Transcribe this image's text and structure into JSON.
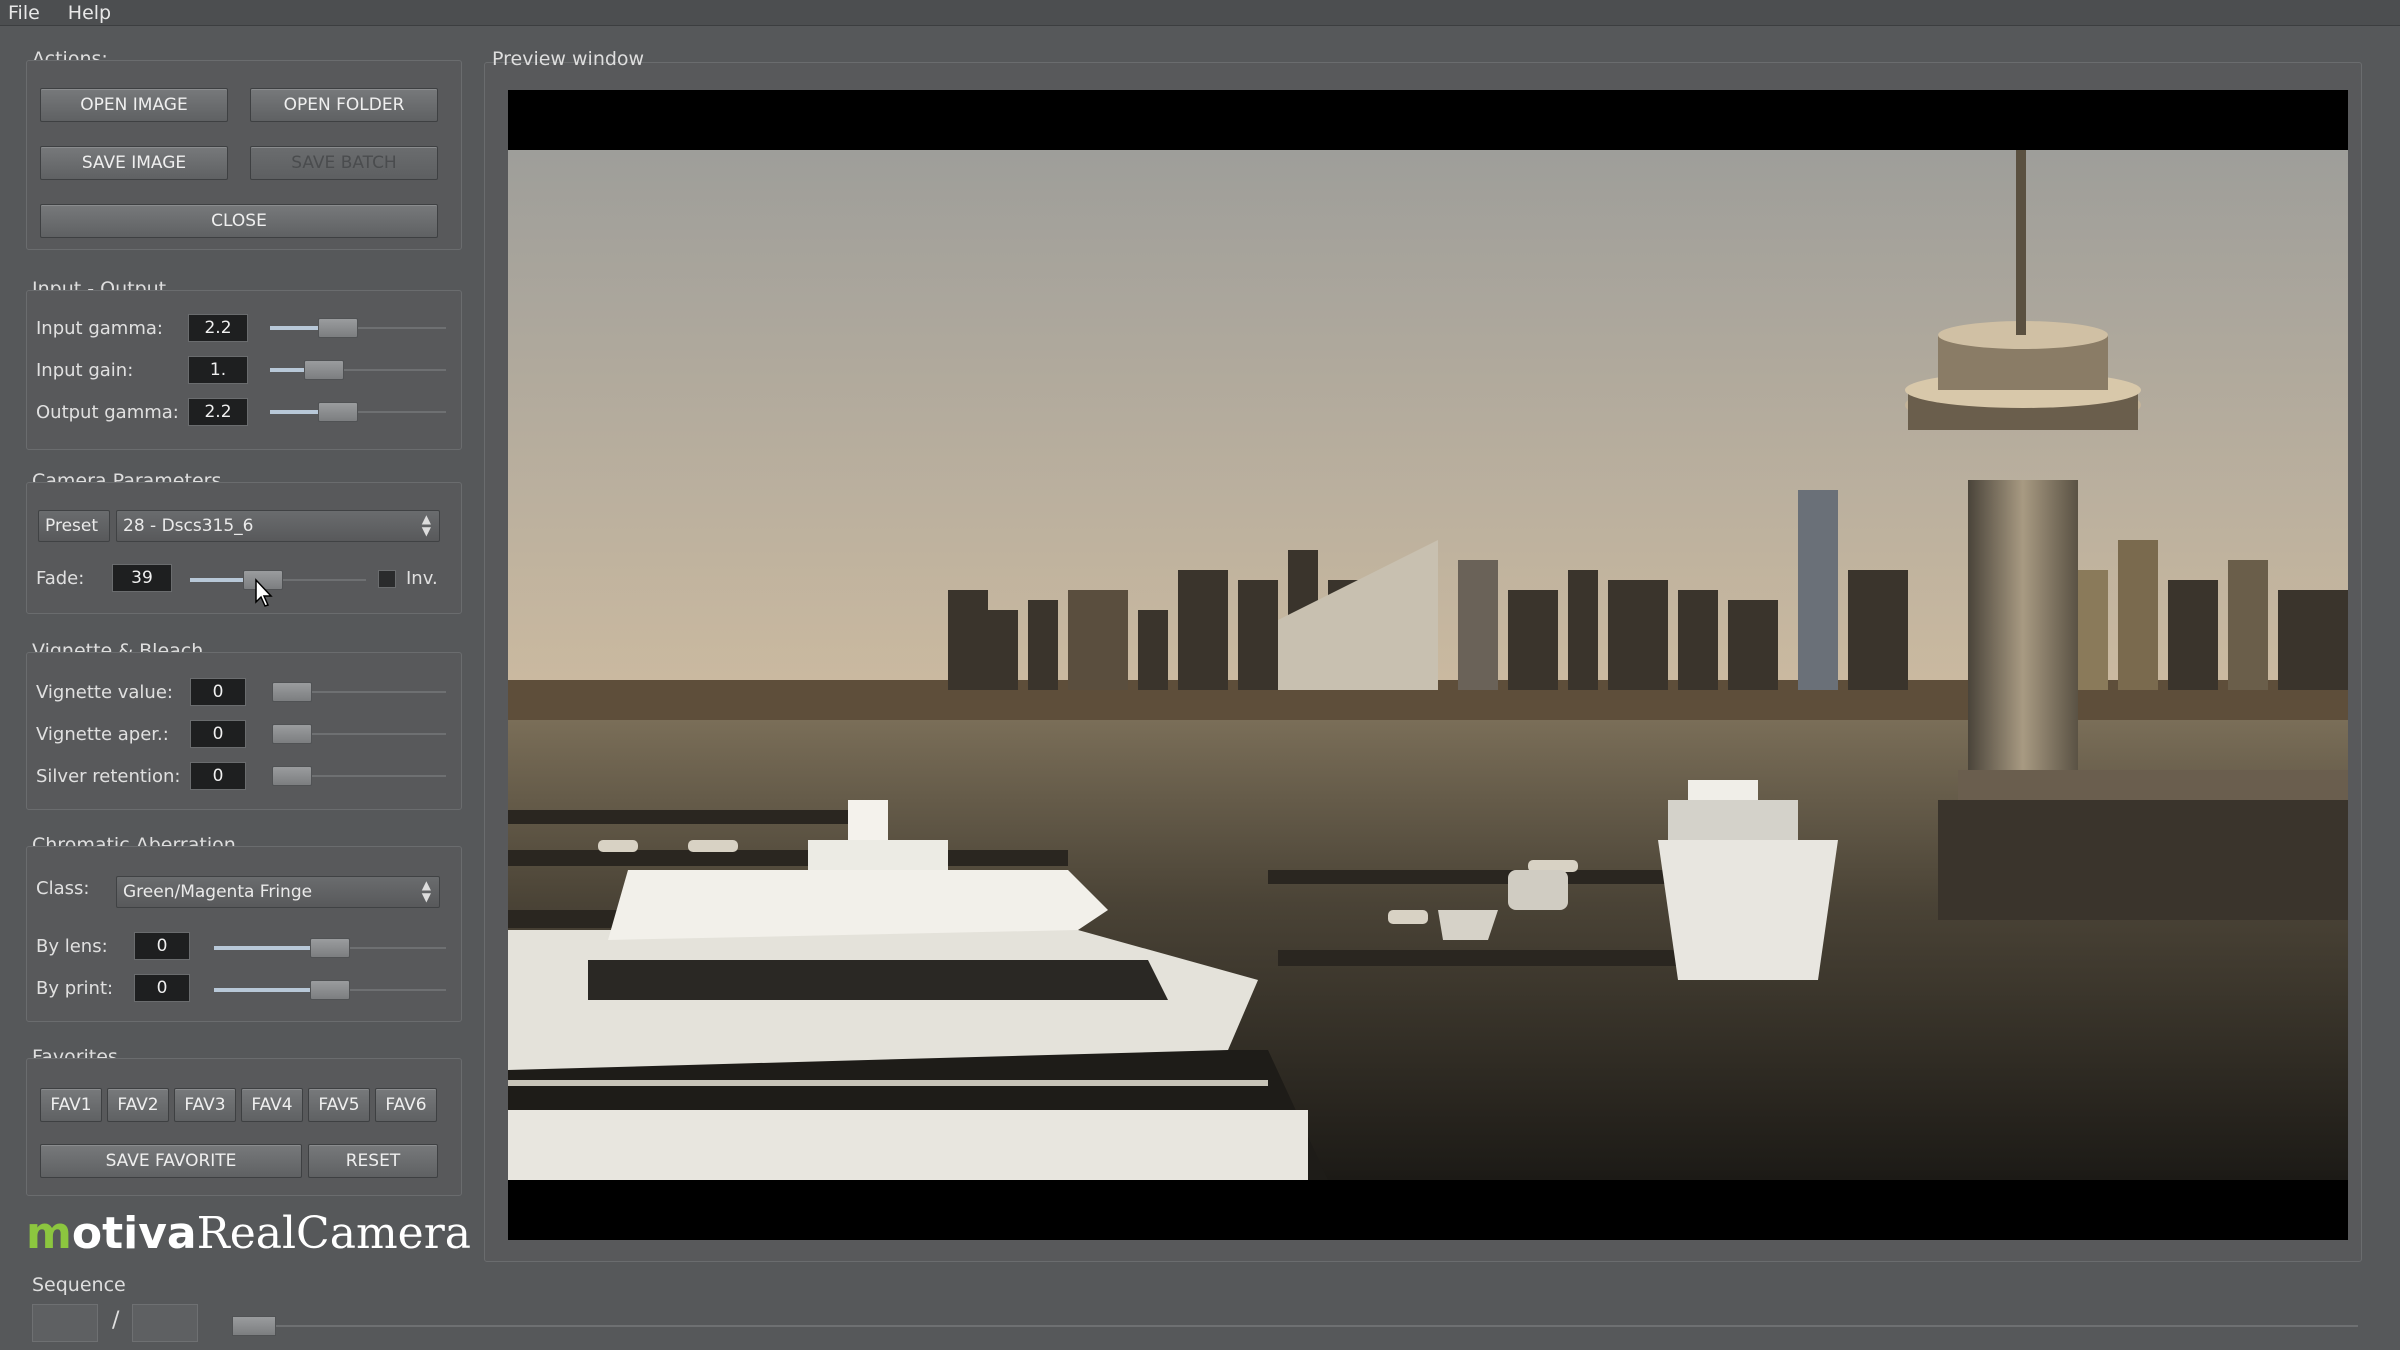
{
  "menu": [
    "File",
    "Help"
  ],
  "actions": {
    "title": "Actions:",
    "open_image": "OPEN IMAGE",
    "open_folder": "OPEN FOLDER",
    "save_image": "SAVE IMAGE",
    "save_batch": "SAVE BATCH",
    "close": "CLOSE"
  },
  "input_output": {
    "title": "Input - Output",
    "input_gamma": {
      "label": "Input gamma:",
      "value": "2.2",
      "level": 0.35
    },
    "input_gain": {
      "label": "Input gain:",
      "value": "1.",
      "level": 0.25
    },
    "output_gamma": {
      "label": "Output gamma:",
      "value": "2.2",
      "level": 0.35
    }
  },
  "camera": {
    "title": "Camera Parameters",
    "preset_label": "Preset",
    "preset_value": "28 - Dscs315_6",
    "fade_label": "Fade:",
    "fade_value": "39",
    "fade_level": 0.39,
    "inv_label": "Inv."
  },
  "vignette": {
    "title": "Vignette & Bleach",
    "value": {
      "label": "Vignette value:",
      "value": "0",
      "level": 0.0
    },
    "aper": {
      "label": "Vignette aper.:",
      "value": "0",
      "level": 0.0
    },
    "silver": {
      "label": "Silver retention:",
      "value": "0",
      "level": 0.0
    }
  },
  "chromatic": {
    "title": "Chromatic Aberration",
    "class_label": "Class:",
    "class_value": "Green/Magenta Fringe",
    "by_lens": {
      "label": "By lens:",
      "value": "0",
      "level": 0.5
    },
    "by_print": {
      "label": "By print:",
      "value": "0",
      "level": 0.5
    }
  },
  "favorites": {
    "title": "Favorites",
    "buttons": [
      "FAV1",
      "FAV2",
      "FAV3",
      "FAV4",
      "FAV5",
      "FAV6"
    ],
    "save": "SAVE FAVORITE",
    "reset": "RESET"
  },
  "logo": {
    "m": "m",
    "motiva": "otiva",
    "real_camera": "RealCamera"
  },
  "preview": {
    "title": "Preview window"
  },
  "sequence": {
    "title": "Sequence",
    "separator": "/",
    "level": 0.0
  }
}
